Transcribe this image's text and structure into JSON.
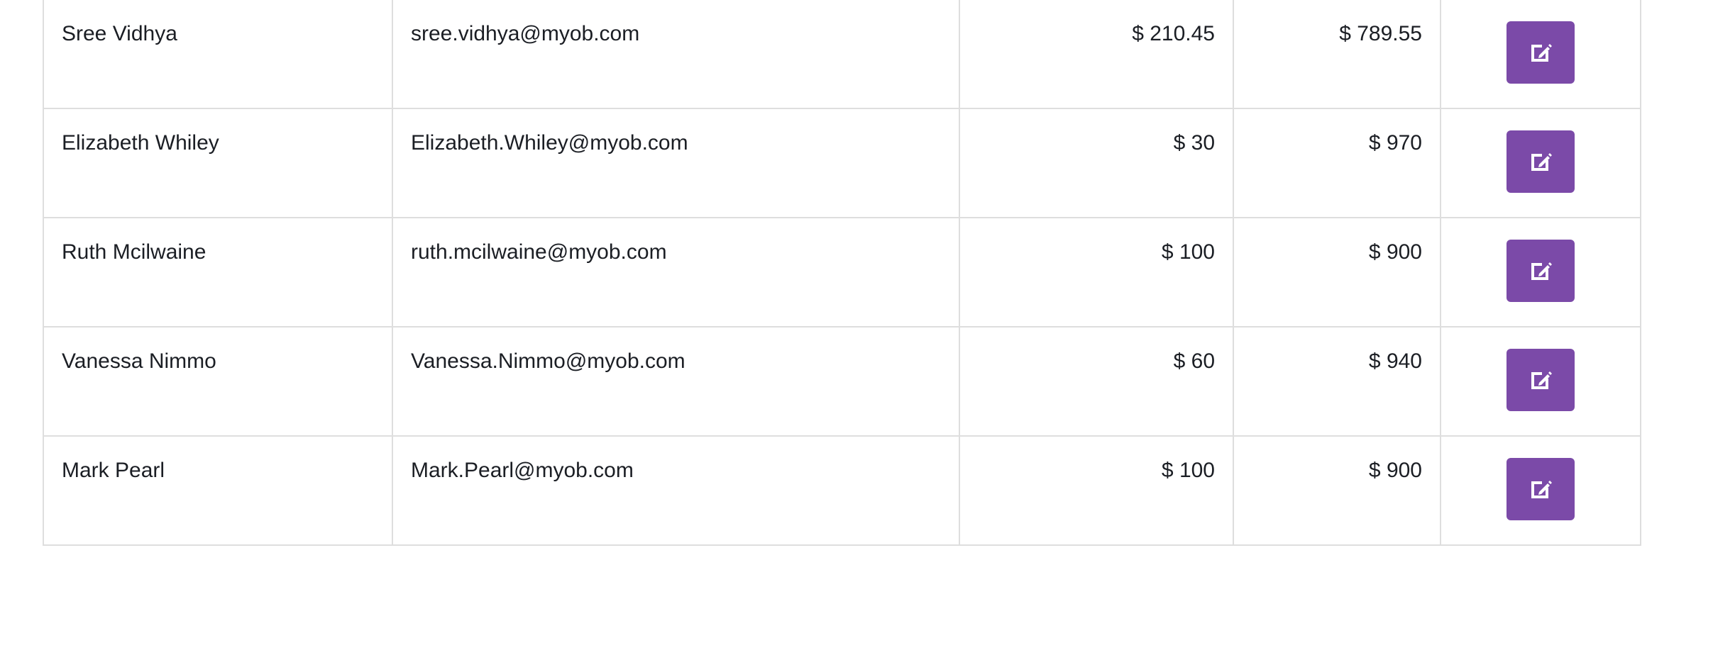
{
  "colors": {
    "accent": "#7b4aa8",
    "border": "#dedede",
    "text": "#1b1e24",
    "icon": "#ffffff"
  },
  "table": {
    "rows": [
      {
        "name": "Sree Vidhya",
        "email": "sree.vidhya@myob.com",
        "paid": "$ 210.45",
        "remaining": "$ 789.55",
        "action_icon": "edit-icon"
      },
      {
        "name": "Elizabeth Whiley",
        "email": "Elizabeth.Whiley@myob.com",
        "paid": "$ 30",
        "remaining": "$ 970",
        "action_icon": "edit-icon"
      },
      {
        "name": "Ruth Mcilwaine",
        "email": "ruth.mcilwaine@myob.com",
        "paid": "$ 100",
        "remaining": "$ 900",
        "action_icon": "edit-icon"
      },
      {
        "name": "Vanessa Nimmo",
        "email": "Vanessa.Nimmo@myob.com",
        "paid": "$ 60",
        "remaining": "$ 940",
        "action_icon": "edit-icon"
      },
      {
        "name": "Mark Pearl",
        "email": "Mark.Pearl@myob.com",
        "paid": "$ 100",
        "remaining": "$ 900",
        "action_icon": "edit-icon"
      }
    ]
  }
}
